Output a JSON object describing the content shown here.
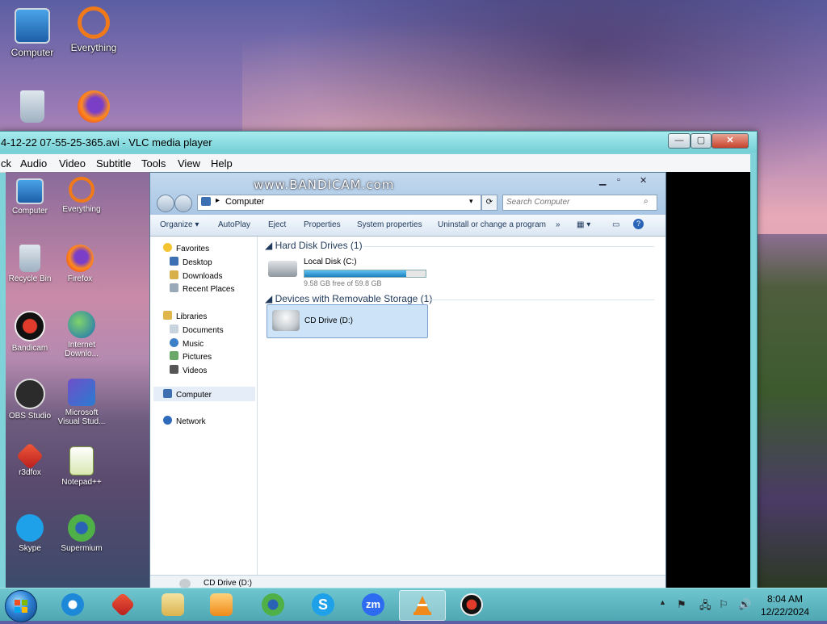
{
  "desktop": {
    "icons": [
      {
        "label": "Computer"
      },
      {
        "label": "Everything"
      }
    ]
  },
  "vlc": {
    "title": "4-12-22 07-55-25-365.avi - VLC media player",
    "menu": [
      "ck",
      "Audio",
      "Video",
      "Subtitle",
      "Tools",
      "View",
      "Help"
    ],
    "controls": {
      "minimize": "—",
      "maximize": "▢",
      "close": "✕"
    }
  },
  "inner_desktop": {
    "icons": [
      {
        "label": "Computer"
      },
      {
        "label": "Everything"
      },
      {
        "label": "Recycle Bin"
      },
      {
        "label": "Firefox"
      },
      {
        "label": "Bandicam"
      },
      {
        "label": "Internet Downlo..."
      },
      {
        "label": "OBS Studio"
      },
      {
        "label": "Microsoft Visual Stud..."
      },
      {
        "label": "r3dfox"
      },
      {
        "label": "Notepad++"
      },
      {
        "label": "Skype"
      },
      {
        "label": "Supermium"
      }
    ]
  },
  "explorer": {
    "watermark": "www.BANDICAM.com",
    "address": "Computer",
    "search_placeholder": "Search Computer",
    "commands": [
      "Organize ▾",
      "AutoPlay",
      "Eject",
      "Properties",
      "System properties",
      "Uninstall or change a program",
      "»"
    ],
    "nav": {
      "favorites": "Favorites",
      "desktop": "Desktop",
      "downloads": "Downloads",
      "recent": "Recent Places",
      "libraries": "Libraries",
      "documents": "Documents",
      "music": "Music",
      "pictures": "Pictures",
      "videos": "Videos",
      "computer": "Computer",
      "network": "Network"
    },
    "groups": {
      "hdd": "Hard Disk Drives (1)",
      "removable": "Devices with Removable Storage (1)"
    },
    "local_disk": {
      "name": "Local Disk (C:)",
      "free": "9.58 GB free of 59.8 GB",
      "used_fraction": 0.84
    },
    "cd_drive": {
      "name": "CD Drive (D:)"
    },
    "status": "CD Drive (D:)"
  },
  "taskbar": {
    "clock_time": "8:04 AM",
    "clock_date": "12/22/2024",
    "apps": [
      "internet-explorer",
      "r3dfox",
      "file-explorer",
      "media-player",
      "supermium",
      "skype",
      "zoom",
      "vlc",
      "bandicam"
    ],
    "zoom_label": "zm",
    "skype_label": "S"
  }
}
